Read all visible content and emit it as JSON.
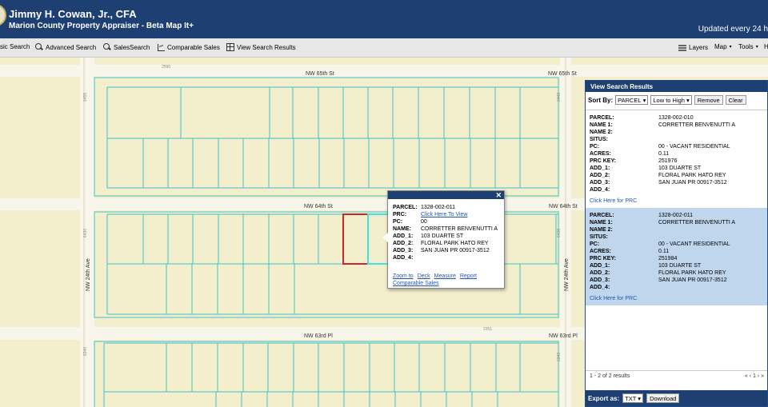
{
  "header": {
    "title": "Jimmy H. Cowan, Jr., CFA",
    "subtitle": "Marion County Property Appraiser - Beta Map It+",
    "updated": "Updated every 24 h"
  },
  "toolbar": {
    "basic_search": "sic Search",
    "advanced_search": "Advanced Search",
    "sales_search": "SalesSearch",
    "comparable_sales": "Comparable Sales",
    "view_search_results": "View Search Results",
    "layers": "Layers",
    "map": "Map",
    "tools": "Tools",
    "help": "H"
  },
  "map": {
    "streets": {
      "nw65th_left": "NW 65th St",
      "nw65th_right": "NW 65th St",
      "nw64th_left": "NW 64th St",
      "nw64th_right": "NW 64th St",
      "nw63rd_left": "NW 63rd Pl",
      "nw63rd_right": "NW 63rd Pl",
      "nw24th_left": "NW 24th Ave",
      "nw24th_right": "NW 24th Ave"
    },
    "address_numbers": {
      "n2590": "2590",
      "n2351": "2351",
      "n6455": "6455",
      "n6430": "6430",
      "n6340": "6340",
      "n6449": "6449",
      "n6438": "6438",
      "n6343": "6343"
    }
  },
  "popup": {
    "fields": [
      {
        "key": "PARCEL:",
        "value": "1328-002-011"
      },
      {
        "key": "PRC:",
        "value": "Click Here To View"
      },
      {
        "key": "PC:",
        "value": "00"
      },
      {
        "key": "NAME:",
        "value": "CORRETTER BENVENUTTI A"
      },
      {
        "key": "ADD_1:",
        "value": "103 DUARTE ST"
      },
      {
        "key": "ADD_2:",
        "value": "FLORAL PARK HATO REY"
      },
      {
        "key": "ADD_3:",
        "value": "SAN JUAN PR 00917-3512"
      },
      {
        "key": "ADD_4:",
        "value": ""
      }
    ],
    "links": {
      "zoom": "Zoom to",
      "deck": "Deck",
      "measure": "Measure",
      "report": "Report",
      "comparable": "Comparable Sales"
    },
    "close": "✕"
  },
  "panel": {
    "title": "View Search Results",
    "sort_label": "Sort By:",
    "sort_field": "PARCEL",
    "sort_order": "Low to High",
    "remove": "Remove",
    "clear": "Clear",
    "results": [
      {
        "fields": [
          {
            "key": "PARCEL:",
            "value": "1328-002-010"
          },
          {
            "key": "NAME 1:",
            "value": "CORRETTER BENVENUTTI A"
          },
          {
            "key": "NAME 2:",
            "value": ""
          },
          {
            "key": "SITUS:",
            "value": ""
          },
          {
            "key": "PC:",
            "value": "00 - VACANT RESIDENTIAL"
          },
          {
            "key": "ACRES:",
            "value": "0.11"
          },
          {
            "key": "PRC KEY:",
            "value": "251976"
          },
          {
            "key": "ADD_1:",
            "value": "103 DUARTE ST"
          },
          {
            "key": "ADD_2:",
            "value": "FLORAL PARK HATO REY"
          },
          {
            "key": "ADD_3:",
            "value": "SAN JUAN PR 00917-3512"
          },
          {
            "key": "ADD_4:",
            "value": ""
          }
        ],
        "prc_link": "Click Here for PRC"
      },
      {
        "fields": [
          {
            "key": "PARCEL:",
            "value": "1328-002-011"
          },
          {
            "key": "NAME 1:",
            "value": "CORRETTER BENVENUTTI A"
          },
          {
            "key": "NAME 2:",
            "value": ""
          },
          {
            "key": "SITUS:",
            "value": ""
          },
          {
            "key": "PC:",
            "value": "00 - VACANT RESIDENTIAL"
          },
          {
            "key": "ACRES:",
            "value": "0.11"
          },
          {
            "key": "PRC KEY:",
            "value": "251984"
          },
          {
            "key": "ADD_1:",
            "value": "103 DUARTE ST"
          },
          {
            "key": "ADD_2:",
            "value": "FLORAL PARK HATO REY"
          },
          {
            "key": "ADD_3:",
            "value": "SAN JUAN PR 00917-3512"
          },
          {
            "key": "ADD_4:",
            "value": ""
          }
        ],
        "prc_link": "Click Here for PRC"
      }
    ],
    "pager_text": "1 - 2 of 2 results",
    "pager_nav": "« ‹ 1 › »",
    "export_label": "Export as:",
    "export_format": "TXT",
    "download": "Download"
  },
  "colors": {
    "header_bg": "#1d3f72",
    "map_bg": "#f3efcd",
    "parcel_line": "#3fc0c8",
    "selected_parcel": "#c62828",
    "highlight_parcel": "#40e0e8",
    "selected_row": "#bfd6ec"
  }
}
